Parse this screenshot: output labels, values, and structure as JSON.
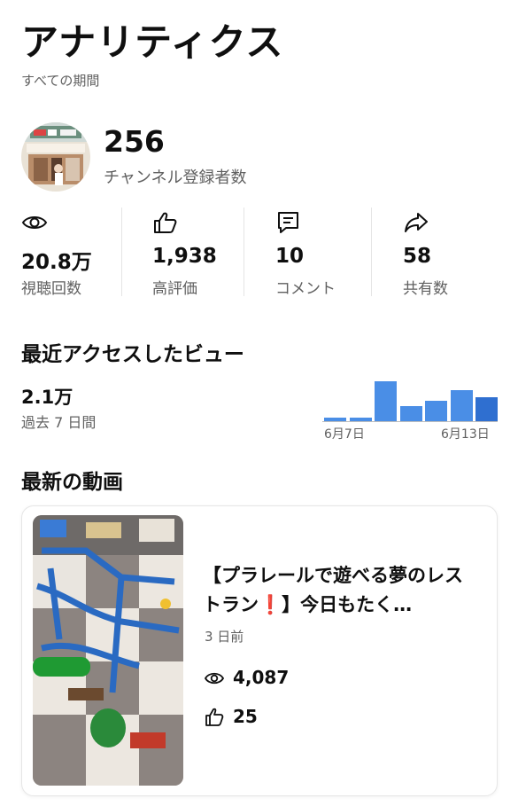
{
  "header": {
    "title": "アナリティクス",
    "subtitle": "すべての期間"
  },
  "channel": {
    "subscriber_count": "256",
    "subscriber_label": "チャンネル登録者数"
  },
  "stats": [
    {
      "icon": "eye-icon",
      "value": "20.8万",
      "label": "視聴回数"
    },
    {
      "icon": "thumbs-up-icon",
      "value": "1,938",
      "label": "高評価"
    },
    {
      "icon": "comment-icon",
      "value": "10",
      "label": "コメント"
    },
    {
      "icon": "share-icon",
      "value": "58",
      "label": "共有数"
    }
  ],
  "recent_views": {
    "heading": "最近アクセスしたビュー",
    "value": "2.1万",
    "period": "過去 7 日間",
    "chart_data": {
      "type": "bar",
      "categories": [
        "6月7日",
        "",
        "",
        "",
        "",
        "",
        "6月13日"
      ],
      "values": [
        0.08,
        0.08,
        1.0,
        0.38,
        0.5,
        0.78,
        0.6
      ],
      "tick_labels": [
        "6月7日",
        "6月13日"
      ],
      "color": "#4a8ee6"
    }
  },
  "latest_videos": {
    "heading": "最新の動画",
    "video": {
      "title_part1": "【プラレールで遊べる夢のレストラン",
      "title_emoji": "❗",
      "title_part2": "】今日もたく…",
      "age": "3 日前",
      "views": "4,087",
      "likes": "25"
    }
  }
}
